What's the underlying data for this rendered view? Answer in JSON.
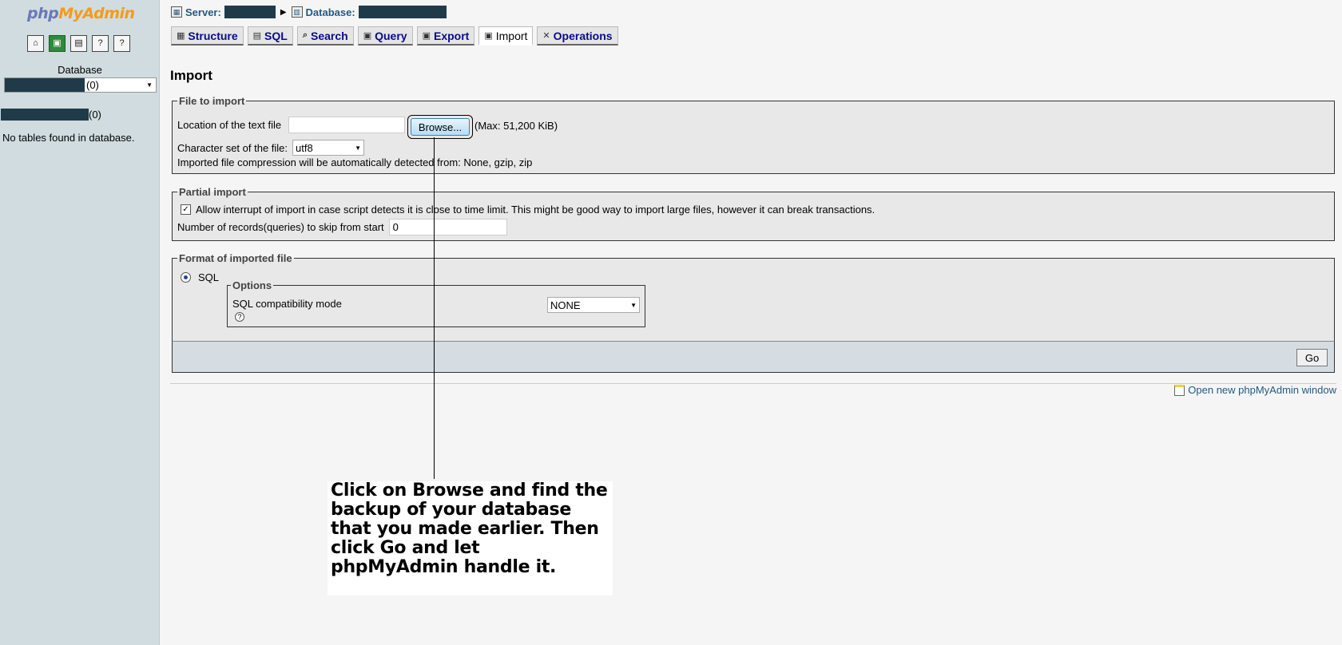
{
  "left": {
    "logo": {
      "part1": "php",
      "part2": "MyAdmin"
    },
    "icons": [
      "home-icon",
      "query-window-icon",
      "sql-icon",
      "docs-icon",
      "help-icon"
    ],
    "database_label": "Database",
    "db_select_count": "(0)",
    "db_link_count": "(0)",
    "no_tables": "No tables found in database."
  },
  "topbar": {
    "server_label": "Server:",
    "database_label": "Database:"
  },
  "tabs": [
    {
      "label": "Structure",
      "icon": "structure-icon"
    },
    {
      "label": "SQL",
      "icon": "sql-icon"
    },
    {
      "label": "Search",
      "icon": "search-icon"
    },
    {
      "label": "Query",
      "icon": "query-icon"
    },
    {
      "label": "Export",
      "icon": "export-icon"
    },
    {
      "label": "Import",
      "icon": "import-icon",
      "active": true
    },
    {
      "label": "Operations",
      "icon": "operations-icon"
    }
  ],
  "page_title": "Import",
  "file_to_import": {
    "legend": "File to import",
    "location_label": "Location of the text file",
    "location_value": "",
    "browse_label": "Browse...",
    "max_size": "(Max: 51,200 KiB)",
    "charset_label": "Character set of the file:",
    "charset_value": "utf8",
    "compression_note": "Imported file compression will be automatically detected from: None, gzip, zip"
  },
  "partial_import": {
    "legend": "Partial import",
    "allow_interrupt_label": "Allow interrupt of import in case script detects it is close to time limit. This might be good way to import large files, however it can break transactions.",
    "allow_interrupt_checked": true,
    "skip_label": "Number of records(queries) to skip from start",
    "skip_value": "0"
  },
  "format": {
    "legend": "Format of imported file",
    "sql_label": "SQL",
    "options_legend": "Options",
    "compat_label": "SQL compatibility mode",
    "compat_value": "NONE",
    "help_icon": "help-icon"
  },
  "go_label": "Go",
  "new_window_link": "Open new phpMyAdmin window",
  "callout": "Click on Browse and find the backup of your database that you made earlier. Then click Go and let phpMyAdmin handle it."
}
